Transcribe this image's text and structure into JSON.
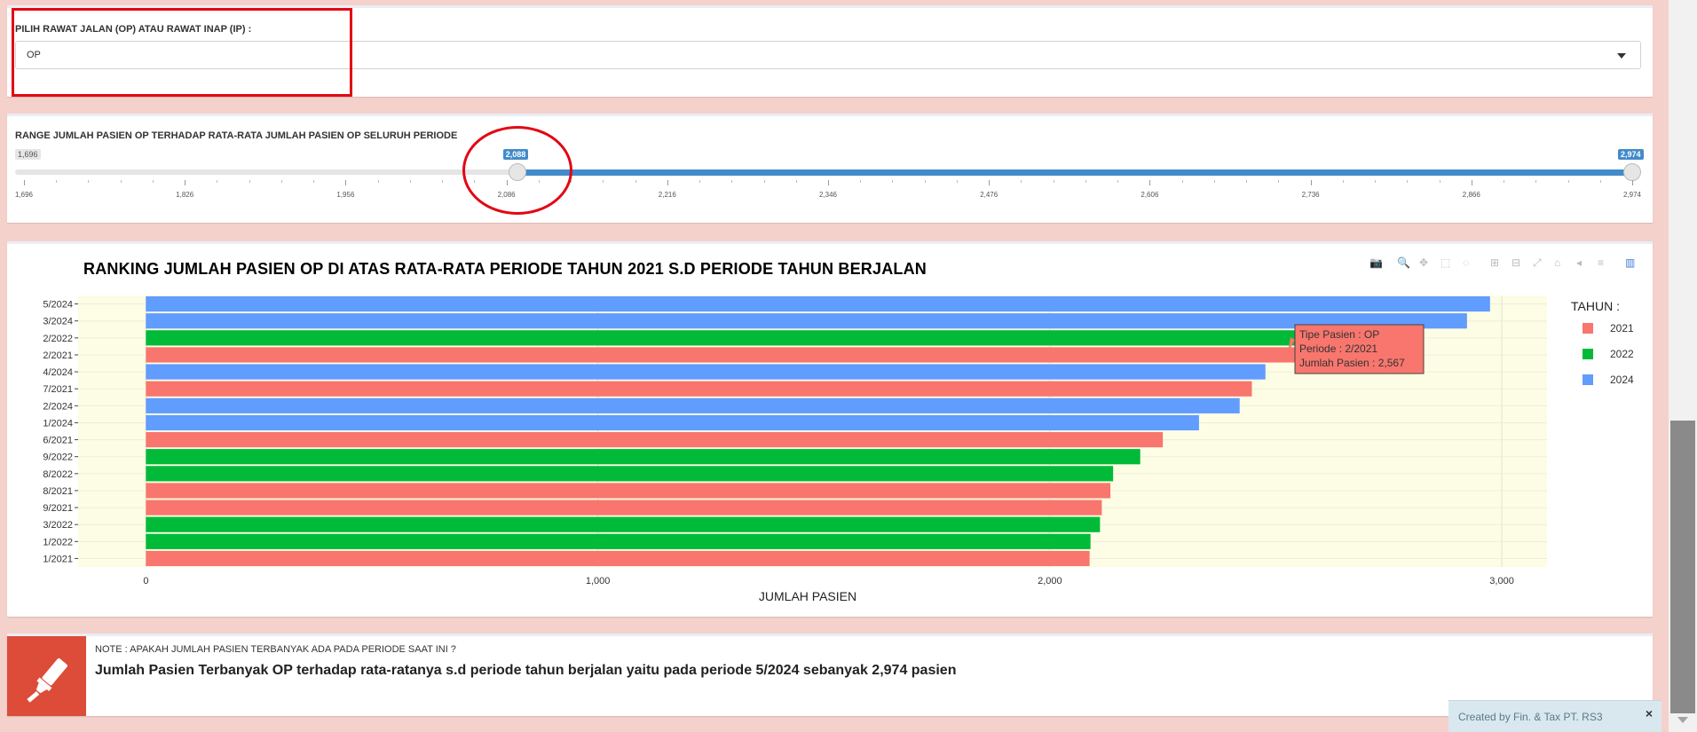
{
  "filter": {
    "label": "PILIH RAWAT JALAN (OP) ATAU RAWAT INAP (IP) :",
    "selected": "OP"
  },
  "range": {
    "label": "RANGE JUMLAH PASIEN OP TERHADAP RATA-RATA JUMLAH PASIEN OP SELURUH PERIODE",
    "min_label": "1,696",
    "from_label": "2,088",
    "to_label": "2,974",
    "min": 1696,
    "max": 2974,
    "from": 2088,
    "to": 2974,
    "ticks": [
      "1,696",
      "1,826",
      "1,956",
      "2,086",
      "2,216",
      "2,346",
      "2,476",
      "2,606",
      "2,736",
      "2,866",
      "2,974"
    ]
  },
  "chart": {
    "title": "RANKING JUMLAH PASIEN OP DI ATAS RATA-RATA PERIODE TAHUN 2021 S.D PERIODE TAHUN BERJALAN",
    "legend_title": "TAHUN :",
    "tooltip": {
      "line1": "Tipe Pasien : OP",
      "line2": "Periode : 2/2021",
      "line3": "Jumlah Pasien : 2,567"
    },
    "toolbar_icons": [
      "camera-icon",
      "zoom-icon",
      "pan-icon",
      "box-select-icon",
      "lasso-select-icon",
      "zoom-in-icon",
      "zoom-out-icon",
      "autoscale-icon",
      "reset-axes-icon",
      "spike-lines-icon",
      "compare-data-icon",
      "plotly-logo-icon"
    ]
  },
  "chart_data": {
    "type": "bar",
    "orientation": "horizontal",
    "title": "RANKING JUMLAH PASIEN OP DI ATAS RATA-RATA PERIODE TAHUN 2021 S.D PERIODE TAHUN BERJALAN",
    "xlabel": "JUMLAH PASIEN",
    "ylabel": "",
    "xlim": [
      -150,
      3100
    ],
    "xticks": [
      0,
      1000,
      2000,
      3000
    ],
    "xtick_labels": [
      "0",
      "1,000",
      "2,000",
      "3,000"
    ],
    "legend": {
      "title": "TAHUN :",
      "position": "right"
    },
    "series_colors": {
      "2021": "#f8766d",
      "2022": "#00ba38",
      "2024": "#619cff"
    },
    "categories": [
      "5/2024",
      "3/2024",
      "2/2022",
      "2/2021",
      "4/2024",
      "7/2021",
      "2/2024",
      "1/2024",
      "6/2021",
      "9/2022",
      "8/2022",
      "8/2021",
      "9/2021",
      "3/2022",
      "1/2022",
      "1/2021"
    ],
    "values": [
      2974,
      2923,
      2568,
      2567,
      2477,
      2447,
      2420,
      2330,
      2250,
      2200,
      2140,
      2134,
      2115,
      2111,
      2090,
      2088
    ],
    "years": [
      "2024",
      "2024",
      "2022",
      "2021",
      "2024",
      "2021",
      "2024",
      "2024",
      "2021",
      "2022",
      "2022",
      "2021",
      "2021",
      "2022",
      "2022",
      "2021"
    ]
  },
  "note": {
    "question": "NOTE : APAKAH JUMLAH PASIEN TERBANYAK ADA PADA PERIODE SAAT INI ?",
    "answer": "Jumlah Pasien Terbanyak OP terhadap rata-ratanya s.d periode tahun berjalan yaitu pada periode 5/2024 sebanyak 2,974 pasien"
  },
  "credit": {
    "text": "Created by Fin. & Tax PT. RS3",
    "close": "×"
  }
}
